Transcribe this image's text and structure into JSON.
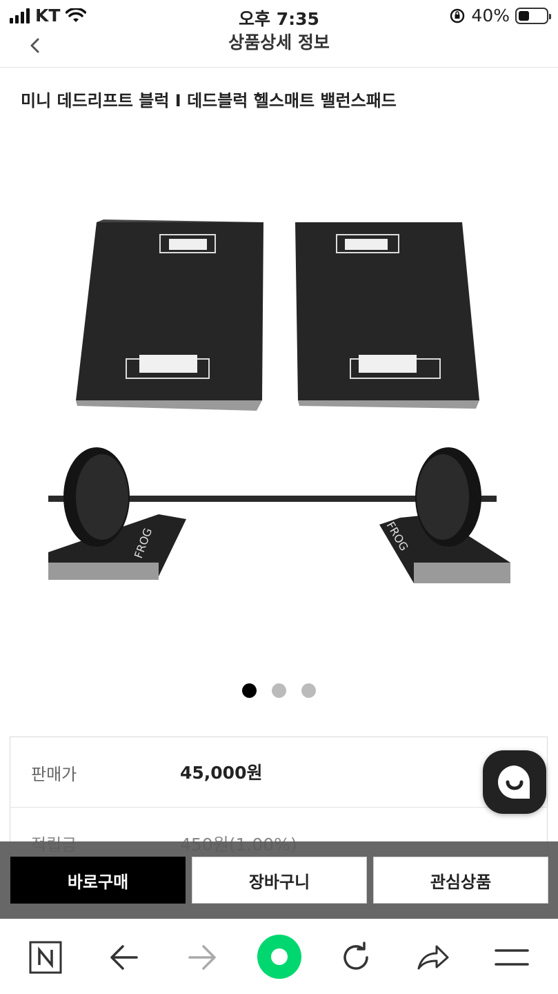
{
  "status_bar": {
    "carrier": "KT",
    "time": "오후 7:35",
    "battery_percent": "40%",
    "battery_level": 0.4
  },
  "header": {
    "title": "상품상세 정보",
    "back_icon": "chevron-left-icon"
  },
  "product": {
    "title": "미니 데드리프트 블럭 I 데드블럭 헬스매트 밸런스패드",
    "image_label": "FROG",
    "carousel": {
      "count": 3,
      "active": 1
    }
  },
  "info": {
    "rows": [
      {
        "label": "판매가",
        "value": "45,000원"
      },
      {
        "label": "적립금",
        "value": "450원(1.00%)"
      }
    ]
  },
  "actions": {
    "buy_now": "바로구매",
    "cart": "장바구니",
    "wishlist": "관심상품"
  },
  "toolbar": {
    "home_icon": "naver-n-icon",
    "back_icon": "arrow-left-icon",
    "forward_icon": "arrow-right-icon",
    "center_icon": "green-circle-icon",
    "reload_icon": "reload-icon",
    "share_icon": "share-icon",
    "menu_icon": "menu-icon"
  },
  "colors": {
    "accent_green": "#00d86f",
    "buy_button": "#000000"
  }
}
